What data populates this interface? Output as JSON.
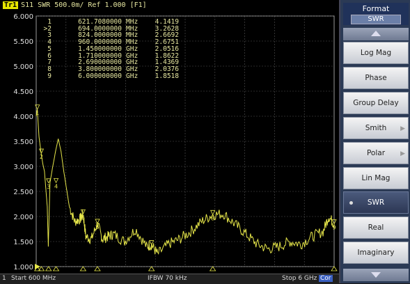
{
  "trace": {
    "label": "Tr1",
    "header_text": "S11  SWR 500.0m/ Ref 1.000  [F1]"
  },
  "y_axis": {
    "ticks": [
      "6.000",
      "5.500",
      "5.000",
      "4.500",
      "4.000",
      "3.500",
      "3.000",
      "2.500",
      "2.000",
      "1.500",
      "1.000"
    ]
  },
  "markers": [
    {
      "id": "1",
      "freq": "621.7080000",
      "unit": "MHz",
      "value": "4.1419"
    },
    {
      "id": ">2",
      "freq": "694.0000000",
      "unit": "MHz",
      "value": "3.2628"
    },
    {
      "id": "3",
      "freq": "824.0000000",
      "unit": "MHz",
      "value": "2.6692"
    },
    {
      "id": "4",
      "freq": "960.0000000",
      "unit": "MHz",
      "value": "2.6751"
    },
    {
      "id": "5",
      "freq": "1.450000000",
      "unit": "GHz",
      "value": "2.0516"
    },
    {
      "id": "6",
      "freq": "1.710000000",
      "unit": "GHz",
      "value": "1.8622"
    },
    {
      "id": "7",
      "freq": "2.690000000",
      "unit": "GHz",
      "value": "1.4369"
    },
    {
      "id": "8",
      "freq": "3.800000000",
      "unit": "GHz",
      "value": "2.0376"
    },
    {
      "id": "9",
      "freq": "6.000000000",
      "unit": "GHz",
      "value": "1.8518"
    }
  ],
  "status_bar": {
    "channel": "1",
    "start": "Start 600 MHz",
    "ifbw": "IFBW 70 kHz",
    "stop": "Stop 6 GHz",
    "cor": "Cor"
  },
  "menu": {
    "title": "Format",
    "current": "SWR",
    "items": [
      {
        "label": "Log Mag",
        "submenu": false,
        "active": false
      },
      {
        "label": "Phase",
        "submenu": false,
        "active": false
      },
      {
        "label": "Group Delay",
        "submenu": false,
        "active": false
      },
      {
        "label": "Smith",
        "submenu": true,
        "active": false
      },
      {
        "label": "Polar",
        "submenu": true,
        "active": false
      },
      {
        "label": "Lin Mag",
        "submenu": false,
        "active": false
      },
      {
        "label": "SWR",
        "submenu": false,
        "active": true
      },
      {
        "label": "Real",
        "submenu": false,
        "active": false
      },
      {
        "label": "Imaginary",
        "submenu": false,
        "active": false
      }
    ]
  },
  "chart_data": {
    "type": "line",
    "title": "",
    "xlabel": "",
    "ylabel": "",
    "xlim": [
      0.6,
      6.0
    ],
    "ylim": [
      1.0,
      6.0
    ],
    "grid": true,
    "trace_color": "#e6e64a",
    "x": [
      0.6,
      0.62,
      0.65,
      0.69,
      0.72,
      0.75,
      0.8,
      0.82,
      0.85,
      0.9,
      0.96,
      1.0,
      1.05,
      1.1,
      1.2,
      1.3,
      1.4,
      1.45,
      1.5,
      1.6,
      1.71,
      1.8,
      1.9,
      2.0,
      2.2,
      2.4,
      2.6,
      2.69,
      2.8,
      3.0,
      3.2,
      3.4,
      3.6,
      3.8,
      4.0,
      4.2,
      4.4,
      4.6,
      4.8,
      5.0,
      5.2,
      5.4,
      5.6,
      5.8,
      5.9,
      6.0
    ],
    "y": [
      4.0,
      4.14,
      3.6,
      3.26,
      3.05,
      2.9,
      2.2,
      1.4,
      2.67,
      3.0,
      3.35,
      3.55,
      3.3,
      2.9,
      2.2,
      1.9,
      1.95,
      2.05,
      1.6,
      1.55,
      1.86,
      1.55,
      1.6,
      1.65,
      1.5,
      1.75,
      1.4,
      1.44,
      1.25,
      1.45,
      1.55,
      1.7,
      1.9,
      2.04,
      2.05,
      1.85,
      1.65,
      1.45,
      1.35,
      1.4,
      1.5,
      1.45,
      1.6,
      1.7,
      2.0,
      1.85
    ],
    "markers": [
      {
        "name": "1",
        "x": 0.621708,
        "y": 4.1419
      },
      {
        "name": "2",
        "x": 0.694,
        "y": 3.2628
      },
      {
        "name": "3",
        "x": 0.824,
        "y": 2.6692
      },
      {
        "name": "4",
        "x": 0.96,
        "y": 2.6751
      },
      {
        "name": "5",
        "x": 1.45,
        "y": 2.0516
      },
      {
        "name": "6",
        "x": 1.71,
        "y": 1.8622
      },
      {
        "name": "7",
        "x": 2.69,
        "y": 1.4369
      },
      {
        "name": "8",
        "x": 3.8,
        "y": 2.0376
      },
      {
        "name": "9",
        "x": 6.0,
        "y": 1.8518
      }
    ]
  }
}
